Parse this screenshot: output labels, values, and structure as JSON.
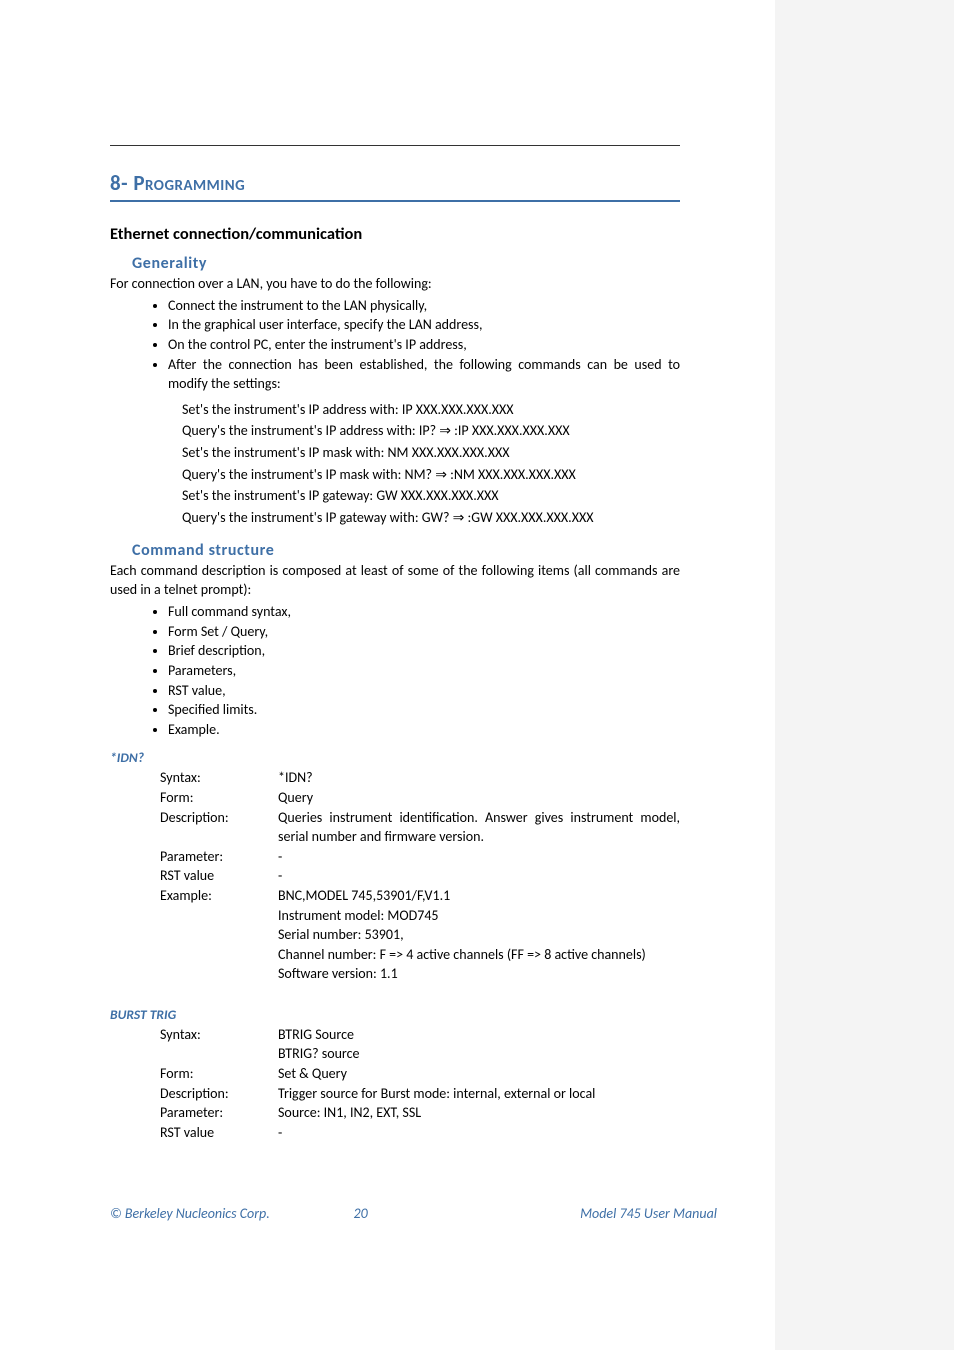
{
  "chapter": {
    "number": "8-",
    "title": "Programming"
  },
  "section_ethernet": {
    "title": "Ethernet connection/communication",
    "generality": {
      "heading": "Generality",
      "intro": "For connection over a LAN, you have to do the following:",
      "bullets": [
        "Connect the instrument to the LAN physically,",
        "In the graphical user interface, specify the LAN address,",
        "On the control PC, enter the instrument's IP address,",
        "After the connection has been established, the following commands can be used to modify the settings:"
      ],
      "settings": [
        "Set's the instrument's IP address with: IP XXX.XXX.XXX.XXX",
        "Query's the instrument's IP address with: IP? ⇒ :IP XXX.XXX.XXX.XXX",
        "Set's the instrument's IP mask with: NM XXX.XXX.XXX.XXX",
        "Query's the instrument's IP mask with: NM? ⇒ :NM XXX.XXX.XXX.XXX",
        "Set's the instrument's IP gateway: GW XXX.XXX.XXX.XXX",
        "Query's the instrument's IP gateway with: GW? ⇒ :GW XXX.XXX.XXX.XXX"
      ]
    },
    "cmdstruct": {
      "heading": "Command structure",
      "intro": "Each command description is composed at least of some of the following items (all commands are used in a telnet prompt):",
      "bullets": [
        "Full command syntax,",
        "Form Set / Query,",
        "Brief description,",
        "Parameters,",
        "RST value,",
        "Specified limits.",
        "Example."
      ]
    }
  },
  "cmd_idn": {
    "name": "*IDN?",
    "syntax_label": "Syntax:",
    "syntax": "*IDN?",
    "form_label": "Form:",
    "form": "Query",
    "desc_label": "Description:",
    "desc": "Queries instrument identification. Answer gives instrument model, serial number and firmware version.",
    "param_label": "Parameter:",
    "param": "-",
    "rst_label": "RST value",
    "rst": "-",
    "example_label": "Example:",
    "example_lines": [
      "BNC,MODEL 745,53901/F,V1.1",
      "Instrument model: MOD745",
      "Serial number: 53901,",
      "Channel number: F => 4 active channels (FF => 8 active channels)",
      "Software version: 1.1"
    ]
  },
  "cmd_burst": {
    "name": "BURST TRIG",
    "syntax_label": "Syntax:",
    "syntax_lines": [
      "BTRIG Source",
      "BTRIG? source"
    ],
    "form_label": "Form:",
    "form": "Set & Query",
    "desc_label": "Description:",
    "desc": "Trigger source for Burst mode: internal, external or local",
    "param_label": "Parameter:",
    "param": "Source: IN1, IN2, EXT, SSL",
    "rst_label": "RST value",
    "rst": "-"
  },
  "footer": {
    "left": "© Berkeley Nucleonics Corp.",
    "page": "20",
    "right": "Model 745 User Manual"
  }
}
